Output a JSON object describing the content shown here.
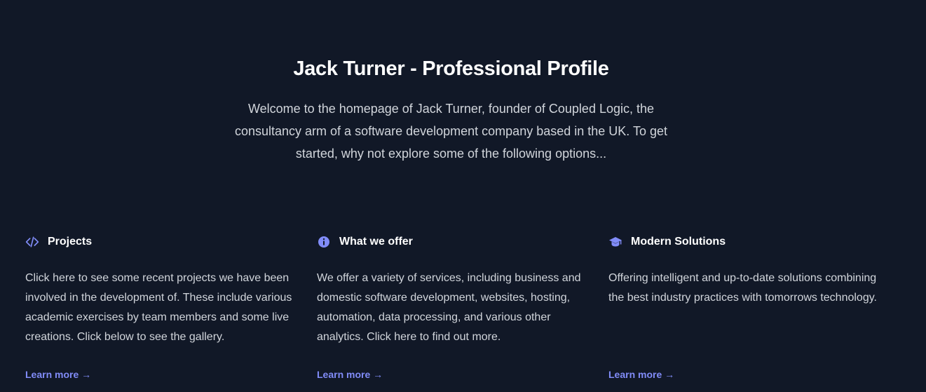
{
  "hero": {
    "title": "Jack Turner - Professional Profile",
    "intro": "Welcome to the homepage of Jack Turner, founder of Coupled Logic, the consultancy arm of a software development company based in the UK. To get started, why not explore some of the following options..."
  },
  "features": [
    {
      "icon": "code-icon",
      "title": "Projects",
      "text": "Click here to see some recent projects we have been involved in the development of. These include various academic exercises by team members and some live creations. Click below to see the gallery.",
      "link": "Learn more →"
    },
    {
      "icon": "info-circle-icon",
      "title": "What we offer",
      "text": "We offer a variety of services, including business and domestic software development, websites, hosting, automation, data processing, and various other analytics. Click here to find out more.",
      "link": "Learn more →"
    },
    {
      "icon": "graduation-cap-icon",
      "title": "Modern Solutions",
      "text": "Offering intelligent and up-to-date solutions combining the best industry practices with tomorrows technology.",
      "link": "Learn more →"
    }
  ],
  "colors": {
    "background": "#111827",
    "accent": "#818cf8",
    "heading": "#ffffff",
    "body_text": "#d1d5db"
  }
}
